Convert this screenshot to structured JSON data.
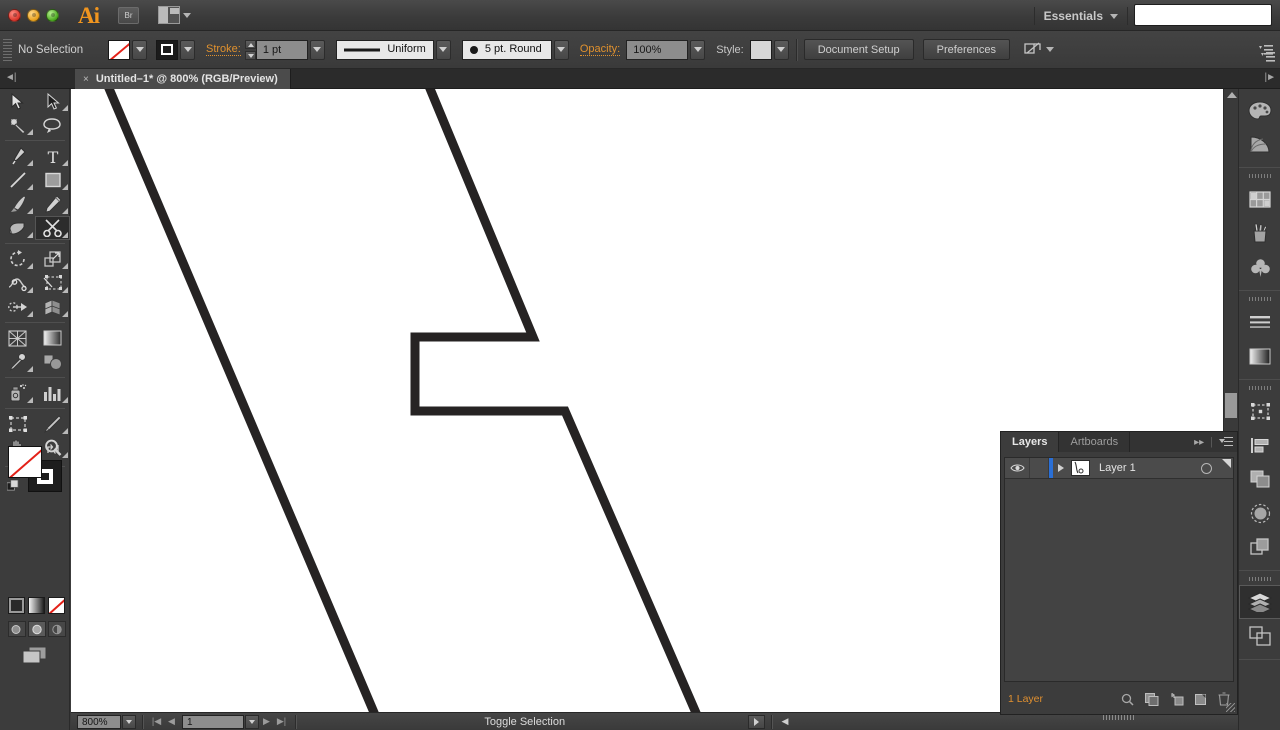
{
  "app": {
    "name": "Adobe Illustrator",
    "logo_text": "Ai",
    "bridge_label": "Br",
    "workspace": "Essentials"
  },
  "control_bar": {
    "selection_status": "No Selection",
    "fill_swatch": "none-swatch",
    "stroke_swatch": "black-stroke-swatch",
    "stroke_label": "Stroke:",
    "stroke_weight": "1 pt",
    "profile_value": "Uniform",
    "brush_value": "5 pt. Round",
    "opacity_label": "Opacity:",
    "opacity_value": "100%",
    "style_label": "Style:",
    "document_setup_label": "Document Setup",
    "preferences_label": "Preferences"
  },
  "document_tab": {
    "close_glyph": "×",
    "title": "Untitled–1* @ 800% (RGB/Preview)"
  },
  "toolbox": {
    "selected_tool": "scissors-tool",
    "tools": [
      {
        "name": "selection-tool",
        "row": 0,
        "col": 0
      },
      {
        "name": "direct-selection-tool",
        "row": 0,
        "col": 1
      },
      {
        "name": "magic-wand-tool",
        "row": 1,
        "col": 0
      },
      {
        "name": "lasso-tool",
        "row": 1,
        "col": 1
      },
      {
        "name": "pen-tool",
        "row": 2,
        "col": 0
      },
      {
        "name": "type-tool",
        "row": 2,
        "col": 1
      },
      {
        "name": "line-segment-tool",
        "row": 3,
        "col": 0
      },
      {
        "name": "rectangle-tool",
        "row": 3,
        "col": 1
      },
      {
        "name": "paintbrush-tool",
        "row": 4,
        "col": 0
      },
      {
        "name": "pencil-tool",
        "row": 4,
        "col": 1
      },
      {
        "name": "blob-brush-tool",
        "row": 5,
        "col": 0
      },
      {
        "name": "scissors-tool",
        "row": 5,
        "col": 1
      },
      {
        "name": "rotate-tool",
        "row": 6,
        "col": 0
      },
      {
        "name": "scale-tool",
        "row": 6,
        "col": 1
      },
      {
        "name": "width-tool",
        "row": 7,
        "col": 0
      },
      {
        "name": "free-transform-tool",
        "row": 7,
        "col": 1
      },
      {
        "name": "shape-builder-tool",
        "row": 8,
        "col": 0
      },
      {
        "name": "perspective-grid-tool",
        "row": 8,
        "col": 1
      },
      {
        "name": "mesh-tool",
        "row": 9,
        "col": 0
      },
      {
        "name": "gradient-tool",
        "row": 9,
        "col": 1
      },
      {
        "name": "eyedropper-tool",
        "row": 10,
        "col": 0
      },
      {
        "name": "blend-tool",
        "row": 10,
        "col": 1
      },
      {
        "name": "symbol-sprayer-tool",
        "row": 11,
        "col": 0
      },
      {
        "name": "column-graph-tool",
        "row": 11,
        "col": 1
      },
      {
        "name": "artboard-tool",
        "row": 12,
        "col": 0
      },
      {
        "name": "slice-tool",
        "row": 12,
        "col": 1
      },
      {
        "name": "hand-tool",
        "row": 13,
        "col": 0
      },
      {
        "name": "zoom-tool",
        "row": 13,
        "col": 1
      }
    ],
    "fill_state": "none",
    "stroke_state": "black",
    "color_modes": [
      "color-mode-button",
      "gradient-mode-button",
      "none-mode-button"
    ],
    "draw_modes": [
      "draw-normal-button",
      "draw-behind-button",
      "draw-inside-button"
    ],
    "screen_mode": "change-screen-mode-button"
  },
  "layers_panel": {
    "tabs": [
      {
        "label": "Layers",
        "active": true
      },
      {
        "label": "Artboards",
        "active": false
      }
    ],
    "rows": [
      {
        "name": "Layer 1",
        "visible": true,
        "locked": false,
        "selected": true,
        "color": "#2a6fd6"
      }
    ],
    "footer_count": "1 Layer",
    "footer_icons": [
      "locate-object-icon",
      "make-clipping-mask-icon",
      "create-new-sublayer-icon",
      "create-new-layer-icon",
      "delete-selection-icon"
    ]
  },
  "right_dock": {
    "groups": [
      {
        "icons": [
          "color-panel-icon",
          "color-guide-panel-icon"
        ]
      },
      {
        "icons": [
          "swatches-panel-icon",
          "brushes-panel-icon",
          "symbols-panel-icon"
        ]
      },
      {
        "icons": [
          "stroke-panel-icon",
          "gradient-panel-icon"
        ]
      },
      {
        "icons": [
          "transform-panel-icon",
          "align-panel-icon",
          "pathfinder-panel-icon",
          "transparency-panel-icon",
          "appearance-panel-icon"
        ]
      },
      {
        "icons": [
          "layers-panel-icon",
          "artboards-panel-icon"
        ],
        "selected": "layers-panel-icon"
      }
    ]
  },
  "status_bar": {
    "zoom_level": "800%",
    "page_number": "1",
    "status_text": "Toggle Selection"
  },
  "artwork": {
    "stroke_color": "#262323",
    "stroke_width_px": 9,
    "background": "#ffffff",
    "description": "open path with two long diagonal strokes and a rectangular notch",
    "paths": [
      "M 34,-10 L 310,640",
      "M 355,-10 L 462,248 L 344,248 L 344,322 L 494,322 L 632,640"
    ]
  }
}
